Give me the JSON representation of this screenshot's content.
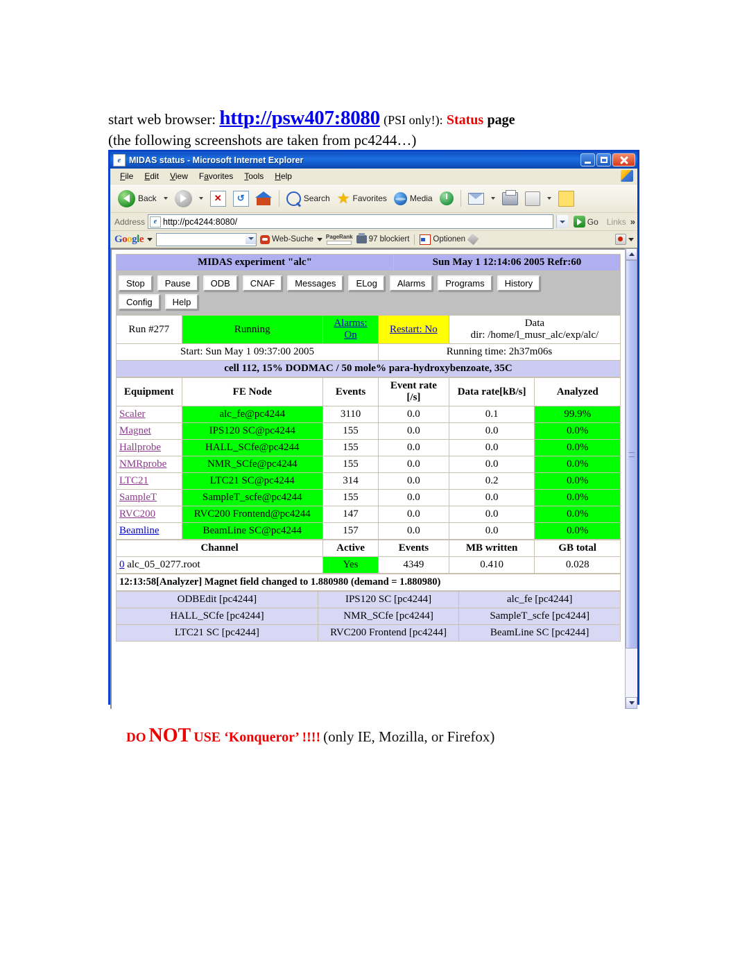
{
  "intro": {
    "prefix": "start web browser:",
    "url": "http://psw407:8080",
    "psi_note": "(PSI only!):",
    "status_word": "Status",
    "page_word": "page",
    "line2": "(the following screenshots are taken from pc4244…)"
  },
  "browser": {
    "title": "MIDAS status - Microsoft Internet Explorer",
    "menu": [
      "File",
      "Edit",
      "View",
      "Favorites",
      "Tools",
      "Help"
    ],
    "toolbar": {
      "back": "Back",
      "search": "Search",
      "favorites": "Favorites",
      "media": "Media"
    },
    "address": {
      "label": "Address",
      "value": "http://pc4244:8080/",
      "go": "Go",
      "links": "Links",
      "chevron": "»"
    },
    "google": {
      "logo": "Google",
      "search_value": "",
      "web_suche": "Web-Suche",
      "pagerank": "PageRank",
      "blocked": "97 blockiert",
      "options": "Optionen"
    },
    "window_buttons": {
      "minimize": "minimize",
      "maximize": "maximize",
      "close": "close"
    }
  },
  "midas": {
    "experiment_title": "MIDAS experiment \"alc\"",
    "clock": "Sun May 1 12:14:06 2005   Refr:60",
    "buttons": [
      "Stop",
      "Pause",
      "ODB",
      "CNAF",
      "Messages",
      "ELog",
      "Alarms",
      "Programs",
      "History",
      "Config",
      "Help"
    ],
    "run": {
      "number": "Run #277",
      "state": "Running",
      "alarms_label": "Alarms:",
      "alarms_value": "On",
      "restart": "Restart: No",
      "data_label": "Data",
      "data_dir": "dir: /home/l_musr_alc/exp/alc/",
      "start": "Start: Sun May 1 09:37:00 2005",
      "running_time": "Running time: 2h37m06s",
      "comment": "cell 112, 15% DODMAC / 50 mole% para-hydroxybenzoate, 35C"
    },
    "equipment_table": {
      "headers": [
        "Equipment",
        "FE Node",
        "Events",
        "Event rate [/s]",
        "Data rate[kB/s]",
        "Analyzed"
      ],
      "header_event_rate_line1": "Event rate",
      "header_event_rate_line2": "[/s]",
      "rows": [
        {
          "equipment": "Scaler",
          "fe_node": "alc_fe@pc4244",
          "events": "3110",
          "event_rate": "0.0",
          "data_rate": "0.1",
          "analyzed": "99.9%"
        },
        {
          "equipment": "Magnet",
          "fe_node": "IPS120 SC@pc4244",
          "events": "155",
          "event_rate": "0.0",
          "data_rate": "0.0",
          "analyzed": "0.0%"
        },
        {
          "equipment": "Hallprobe",
          "fe_node": "HALL_SCfe@pc4244",
          "events": "155",
          "event_rate": "0.0",
          "data_rate": "0.0",
          "analyzed": "0.0%"
        },
        {
          "equipment": "NMRprobe",
          "fe_node": "NMR_SCfe@pc4244",
          "events": "155",
          "event_rate": "0.0",
          "data_rate": "0.0",
          "analyzed": "0.0%"
        },
        {
          "equipment": "LTC21",
          "fe_node": "LTC21 SC@pc4244",
          "events": "314",
          "event_rate": "0.0",
          "data_rate": "0.2",
          "analyzed": "0.0%"
        },
        {
          "equipment": "SampleT",
          "fe_node": "SampleT_scfe@pc4244",
          "events": "155",
          "event_rate": "0.0",
          "data_rate": "0.0",
          "analyzed": "0.0%"
        },
        {
          "equipment": "RVC200",
          "fe_node": "RVC200 Frontend@pc4244",
          "events": "147",
          "event_rate": "0.0",
          "data_rate": "0.0",
          "analyzed": "0.0%"
        },
        {
          "equipment": "Beamline",
          "fe_node": "BeamLine SC@pc4244",
          "events": "157",
          "event_rate": "0.0",
          "data_rate": "0.0",
          "analyzed": "0.0%"
        }
      ]
    },
    "channel_table": {
      "headers": [
        "Channel",
        "Active",
        "Events",
        "MB written",
        "GB total"
      ],
      "row": {
        "index": "0",
        "name": "alc_05_0277.root",
        "active": "Yes",
        "events": "4349",
        "mb_written": "0.410",
        "gb_total": "0.028"
      }
    },
    "message": "12:13:58[Analyzer] Magnet field changed to 1.880980 (demand = 1.880980)",
    "programs": [
      [
        "ODBEdit [pc4244]",
        "IPS120 SC [pc4244]",
        "alc_fe [pc4244]"
      ],
      [
        "HALL_SCfe [pc4244]",
        "NMR_SCfe [pc4244]",
        "SampleT_scfe [pc4244]"
      ],
      [
        "LTC21 SC [pc4244]",
        "RVC200 Frontend [pc4244]",
        "BeamLine SC [pc4244]"
      ]
    ]
  },
  "warning": {
    "do": "DO",
    "not": "NOT",
    "use": "USE ‘Konqueror’ !!!!",
    "rest": "(only IE, Mozilla, or Firefox)"
  },
  "colors": {
    "running_green": "#00ff00",
    "restart_yellow": "#ffff00",
    "header_lavender": "#b0b0f0",
    "ie_blue": "#0a43c4"
  }
}
